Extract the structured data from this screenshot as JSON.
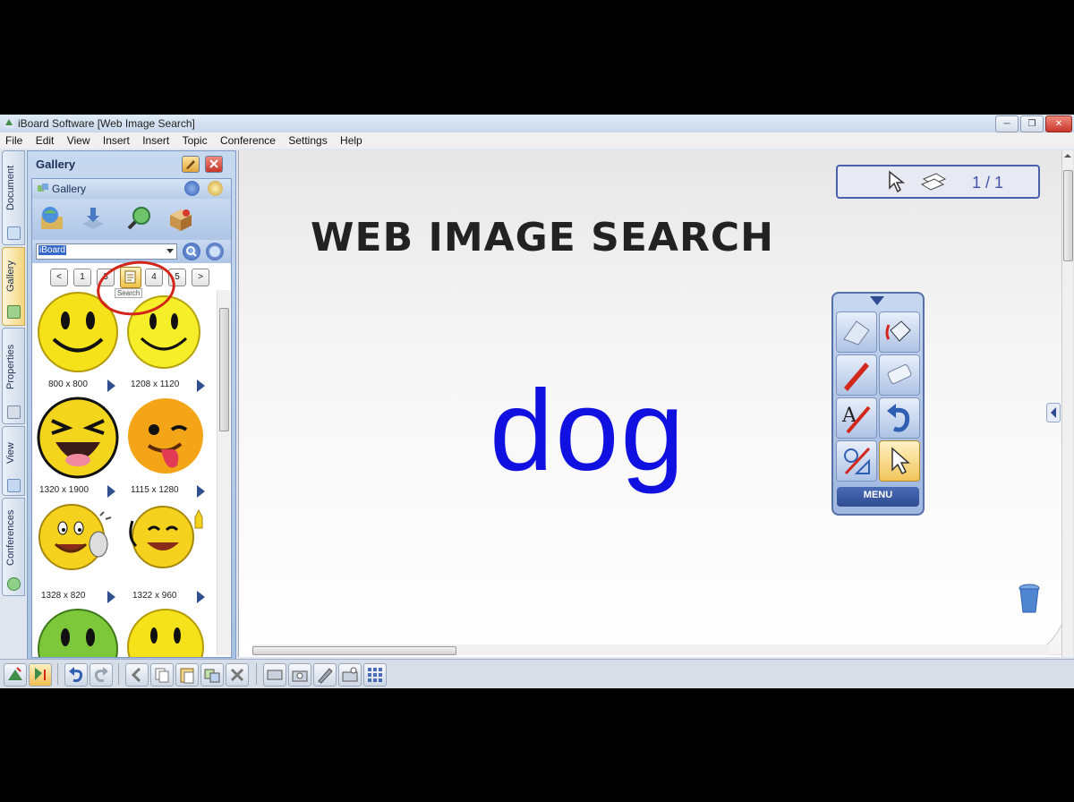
{
  "window": {
    "title": "iBoard Software [Web Image Search]",
    "controls": [
      "minimize",
      "restore",
      "close"
    ]
  },
  "menu": [
    "File",
    "Edit",
    "View",
    "Insert",
    "Insert",
    "Topic",
    "Conference",
    "Settings",
    "Help"
  ],
  "side_tabs": [
    {
      "label": "Document",
      "active": false
    },
    {
      "label": "Gallery",
      "active": true
    },
    {
      "label": "Properties",
      "active": false
    },
    {
      "label": "View",
      "active": false
    },
    {
      "label": "Conferences",
      "active": false
    }
  ],
  "gallery": {
    "panel_title": "Gallery",
    "inner_title": "Gallery",
    "search_value": "iBoard",
    "pager": [
      "<",
      "1",
      "3",
      "",
      "4",
      "5",
      ">"
    ],
    "tooltip": "Search",
    "thumbnails": [
      {
        "size": "800 x 800",
        "icon": "smiley-face"
      },
      {
        "size": "1208 x 1120",
        "icon": "smiley-face"
      },
      {
        "size": "1320 x 1900",
        "icon": "laughing-face"
      },
      {
        "size": "1115 x 1280",
        "icon": "winking-tongue-face"
      },
      {
        "size": "1328 x 820",
        "icon": "phone-smiley"
      },
      {
        "size": "1322 x 960",
        "icon": "thumbs-up-smiley"
      },
      {
        "size": "",
        "icon": "green-smiley"
      },
      {
        "size": "",
        "icon": "smiley-face"
      }
    ]
  },
  "canvas": {
    "heading": "WEB IMAGE SEARCH",
    "word": "dog",
    "page_indicator": "1 / 1",
    "toolbox_menu_label": "MENU",
    "colors": {
      "word": "#1010e0",
      "heading": "#222222",
      "nav_border": "#4b5fae"
    }
  },
  "toolbox": [
    "eraser",
    "fill-bucket",
    "pen",
    "highlighter",
    "text-pen",
    "undo",
    "shape-tool",
    "pointer"
  ]
}
